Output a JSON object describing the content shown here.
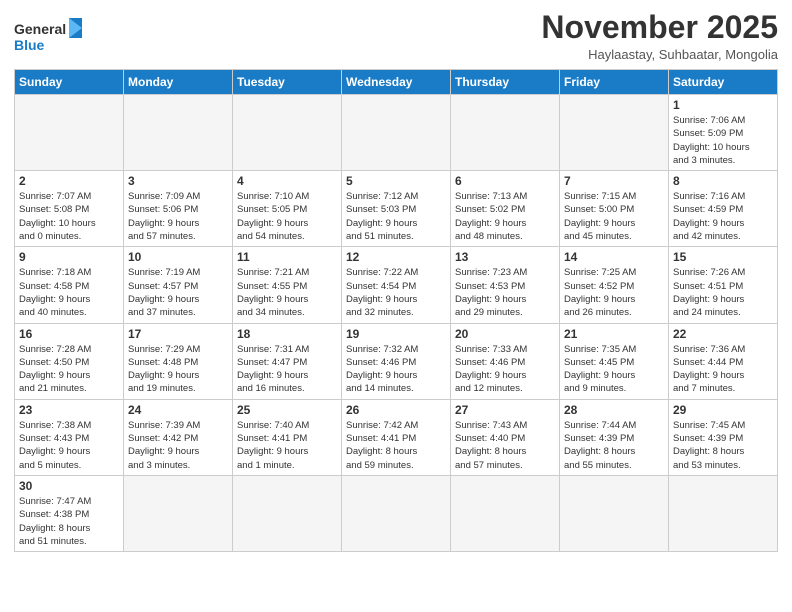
{
  "header": {
    "logo_general": "General",
    "logo_blue": "Blue",
    "month_title": "November 2025",
    "location": "Haylaastay, Suhbaatar, Mongolia"
  },
  "days_of_week": [
    "Sunday",
    "Monday",
    "Tuesday",
    "Wednesday",
    "Thursday",
    "Friday",
    "Saturday"
  ],
  "weeks": [
    [
      {
        "day": "",
        "info": ""
      },
      {
        "day": "",
        "info": ""
      },
      {
        "day": "",
        "info": ""
      },
      {
        "day": "",
        "info": ""
      },
      {
        "day": "",
        "info": ""
      },
      {
        "day": "",
        "info": ""
      },
      {
        "day": "1",
        "info": "Sunrise: 7:06 AM\nSunset: 5:09 PM\nDaylight: 10 hours\nand 3 minutes."
      }
    ],
    [
      {
        "day": "2",
        "info": "Sunrise: 7:07 AM\nSunset: 5:08 PM\nDaylight: 10 hours\nand 0 minutes."
      },
      {
        "day": "3",
        "info": "Sunrise: 7:09 AM\nSunset: 5:06 PM\nDaylight: 9 hours\nand 57 minutes."
      },
      {
        "day": "4",
        "info": "Sunrise: 7:10 AM\nSunset: 5:05 PM\nDaylight: 9 hours\nand 54 minutes."
      },
      {
        "day": "5",
        "info": "Sunrise: 7:12 AM\nSunset: 5:03 PM\nDaylight: 9 hours\nand 51 minutes."
      },
      {
        "day": "6",
        "info": "Sunrise: 7:13 AM\nSunset: 5:02 PM\nDaylight: 9 hours\nand 48 minutes."
      },
      {
        "day": "7",
        "info": "Sunrise: 7:15 AM\nSunset: 5:00 PM\nDaylight: 9 hours\nand 45 minutes."
      },
      {
        "day": "8",
        "info": "Sunrise: 7:16 AM\nSunset: 4:59 PM\nDaylight: 9 hours\nand 42 minutes."
      }
    ],
    [
      {
        "day": "9",
        "info": "Sunrise: 7:18 AM\nSunset: 4:58 PM\nDaylight: 9 hours\nand 40 minutes."
      },
      {
        "day": "10",
        "info": "Sunrise: 7:19 AM\nSunset: 4:57 PM\nDaylight: 9 hours\nand 37 minutes."
      },
      {
        "day": "11",
        "info": "Sunrise: 7:21 AM\nSunset: 4:55 PM\nDaylight: 9 hours\nand 34 minutes."
      },
      {
        "day": "12",
        "info": "Sunrise: 7:22 AM\nSunset: 4:54 PM\nDaylight: 9 hours\nand 32 minutes."
      },
      {
        "day": "13",
        "info": "Sunrise: 7:23 AM\nSunset: 4:53 PM\nDaylight: 9 hours\nand 29 minutes."
      },
      {
        "day": "14",
        "info": "Sunrise: 7:25 AM\nSunset: 4:52 PM\nDaylight: 9 hours\nand 26 minutes."
      },
      {
        "day": "15",
        "info": "Sunrise: 7:26 AM\nSunset: 4:51 PM\nDaylight: 9 hours\nand 24 minutes."
      }
    ],
    [
      {
        "day": "16",
        "info": "Sunrise: 7:28 AM\nSunset: 4:50 PM\nDaylight: 9 hours\nand 21 minutes."
      },
      {
        "day": "17",
        "info": "Sunrise: 7:29 AM\nSunset: 4:48 PM\nDaylight: 9 hours\nand 19 minutes."
      },
      {
        "day": "18",
        "info": "Sunrise: 7:31 AM\nSunset: 4:47 PM\nDaylight: 9 hours\nand 16 minutes."
      },
      {
        "day": "19",
        "info": "Sunrise: 7:32 AM\nSunset: 4:46 PM\nDaylight: 9 hours\nand 14 minutes."
      },
      {
        "day": "20",
        "info": "Sunrise: 7:33 AM\nSunset: 4:46 PM\nDaylight: 9 hours\nand 12 minutes."
      },
      {
        "day": "21",
        "info": "Sunrise: 7:35 AM\nSunset: 4:45 PM\nDaylight: 9 hours\nand 9 minutes."
      },
      {
        "day": "22",
        "info": "Sunrise: 7:36 AM\nSunset: 4:44 PM\nDaylight: 9 hours\nand 7 minutes."
      }
    ],
    [
      {
        "day": "23",
        "info": "Sunrise: 7:38 AM\nSunset: 4:43 PM\nDaylight: 9 hours\nand 5 minutes."
      },
      {
        "day": "24",
        "info": "Sunrise: 7:39 AM\nSunset: 4:42 PM\nDaylight: 9 hours\nand 3 minutes."
      },
      {
        "day": "25",
        "info": "Sunrise: 7:40 AM\nSunset: 4:41 PM\nDaylight: 9 hours\nand 1 minute."
      },
      {
        "day": "26",
        "info": "Sunrise: 7:42 AM\nSunset: 4:41 PM\nDaylight: 8 hours\nand 59 minutes."
      },
      {
        "day": "27",
        "info": "Sunrise: 7:43 AM\nSunset: 4:40 PM\nDaylight: 8 hours\nand 57 minutes."
      },
      {
        "day": "28",
        "info": "Sunrise: 7:44 AM\nSunset: 4:39 PM\nDaylight: 8 hours\nand 55 minutes."
      },
      {
        "day": "29",
        "info": "Sunrise: 7:45 AM\nSunset: 4:39 PM\nDaylight: 8 hours\nand 53 minutes."
      }
    ],
    [
      {
        "day": "30",
        "info": "Sunrise: 7:47 AM\nSunset: 4:38 PM\nDaylight: 8 hours\nand 51 minutes."
      },
      {
        "day": "",
        "info": ""
      },
      {
        "day": "",
        "info": ""
      },
      {
        "day": "",
        "info": ""
      },
      {
        "day": "",
        "info": ""
      },
      {
        "day": "",
        "info": ""
      },
      {
        "day": "",
        "info": ""
      }
    ]
  ]
}
